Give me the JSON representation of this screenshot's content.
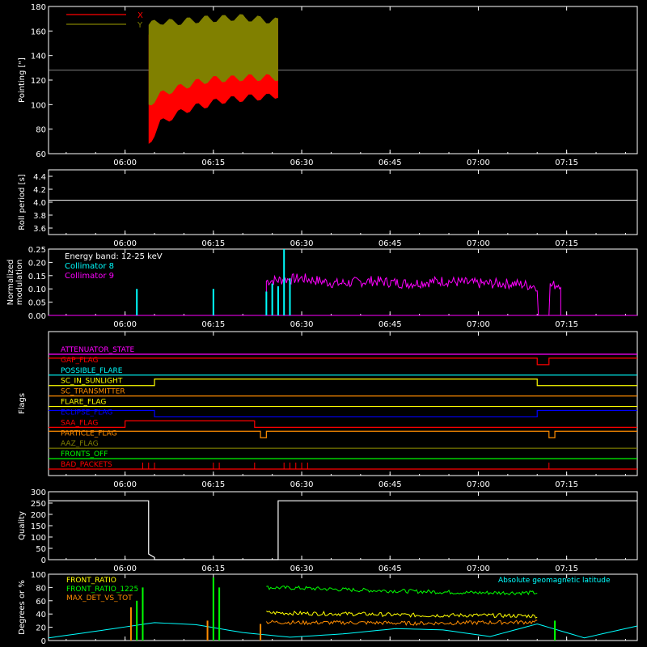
{
  "time_ticks": [
    "06:00",
    "06:15",
    "06:30",
    "06:45",
    "07:00",
    "07:15"
  ],
  "chart_data": [
    {
      "type": "line",
      "panel": "pointing",
      "ylabel": "Pointing [\"]",
      "ylim": [
        60,
        180
      ],
      "yticks": [
        "60",
        "80",
        "100",
        "120",
        "140",
        "160",
        "180"
      ],
      "xlim": [
        "05:47",
        "07:27"
      ],
      "legend": [
        {
          "name": "X",
          "color": "#ff0000"
        },
        {
          "name": "Y",
          "color": "#808000"
        }
      ],
      "reference_value": 128,
      "x": [
        "06:04",
        "06:06",
        "06:08",
        "06:10",
        "06:12",
        "06:14",
        "06:16",
        "06:18",
        "06:20",
        "06:22",
        "06:24",
        "06:26"
      ],
      "series": [
        {
          "name": "X",
          "color": "#ff0000",
          "min": [
            68,
            85,
            90,
            95,
            98,
            100,
            103,
            104,
            105,
            106,
            106,
            108
          ],
          "max": [
            157,
            160,
            162,
            163,
            164,
            165,
            165,
            166,
            167,
            167,
            168,
            168
          ]
        },
        {
          "name": "Y",
          "color": "#808000",
          "min": [
            100,
            108,
            112,
            115,
            118,
            120,
            121,
            121,
            122,
            122,
            122,
            122
          ],
          "max": [
            165,
            168,
            167,
            168,
            169,
            170,
            170,
            171,
            171,
            170,
            169,
            168
          ]
        }
      ]
    },
    {
      "type": "line",
      "panel": "roll_period",
      "ylabel": "Roll period [s]",
      "ylim": [
        3.5,
        4.5
      ],
      "yticks": [
        "3.6",
        "3.8",
        "4.0",
        "4.2",
        "4.4"
      ],
      "series": [
        {
          "name": "",
          "color": "#ffffff",
          "x": [
            "05:47",
            "07:27"
          ],
          "y": [
            4.03,
            4.03
          ]
        }
      ]
    },
    {
      "type": "line",
      "panel": "modulation",
      "ylabel": [
        "Normalized",
        "modulation"
      ],
      "ylim": [
        0,
        0.25
      ],
      "yticks": [
        "0.00",
        "0.05",
        "0.10",
        "0.15",
        "0.20",
        "0.25"
      ],
      "annotation": "Energy band: 12-25 keV",
      "legend": [
        {
          "name": "Collimator 8",
          "color": "#00ffff"
        },
        {
          "name": "Collimator 9",
          "color": "#ff00ff"
        }
      ],
      "series": [
        {
          "name": "Collimator 8",
          "color": "#00ffff",
          "spikes": [
            [
              "06:02",
              0.1
            ],
            [
              "06:15",
              0.1
            ],
            [
              "06:24",
              0.09
            ],
            [
              "06:25",
              0.12
            ],
            [
              "06:26",
              0.11
            ],
            [
              "06:27",
              0.25
            ],
            [
              "06:28",
              0.14
            ]
          ]
        },
        {
          "name": "Collimator 9",
          "color": "#ff00ff",
          "x": [
            "06:24",
            "06:30",
            "06:36",
            "06:42",
            "06:48",
            "06:54",
            "07:00",
            "07:06",
            "07:10",
            "07:12",
            "07:14"
          ],
          "y": [
            0.13,
            0.14,
            0.12,
            0.13,
            0.12,
            0.13,
            0.12,
            0.12,
            0.11,
            0.11,
            0.12
          ]
        }
      ]
    },
    {
      "type": "line",
      "panel": "flags",
      "ylabel": "Flags",
      "flags": [
        {
          "name": "ATTENUATOR_STATE",
          "color": "#ff00ff"
        },
        {
          "name": "GAP_FLAG",
          "color": "#ff0000"
        },
        {
          "name": "POSSIBLE_FLARE",
          "color": "#00ffff"
        },
        {
          "name": "SC_IN_SUNLIGHT",
          "color": "#ffff00"
        },
        {
          "name": "SC_TRANSMITTER",
          "color": "#ff8c00"
        },
        {
          "name": "FLARE_FLAG",
          "color": "#ffff00"
        },
        {
          "name": "ECLIPSE_FLAG",
          "color": "#0000ff"
        },
        {
          "name": "SAA_FLAG",
          "color": "#ff0000"
        },
        {
          "name": "PARTICLE_FLAG",
          "color": "#ff8c00"
        },
        {
          "name": "AAZ_FLAG",
          "color": "#808000"
        },
        {
          "name": "FRONTS_OFF",
          "color": "#00ff00"
        },
        {
          "name": "BAD_PACKETS",
          "color": "#ff0000"
        }
      ]
    },
    {
      "type": "line",
      "panel": "quality",
      "ylabel": "Quality",
      "ylim": [
        0,
        300
      ],
      "yticks": [
        "0",
        "50",
        "100",
        "150",
        "200",
        "250",
        "300"
      ],
      "series": [
        {
          "name": "",
          "color": "#ffffff",
          "x": [
            "05:47",
            "06:04",
            "06:04",
            "06:05",
            "06:05",
            "06:26",
            "06:26",
            "07:27"
          ],
          "y": [
            260,
            260,
            25,
            10,
            0,
            0,
            260,
            260
          ]
        }
      ]
    },
    {
      "type": "line",
      "panel": "ratios",
      "ylabel": "Degrees or %",
      "ylim": [
        0,
        100
      ],
      "yticks": [
        "0",
        "20",
        "40",
        "60",
        "80",
        "100"
      ],
      "legend": [
        {
          "name": "FRONT_RATIO",
          "color": "#ffff00"
        },
        {
          "name": "FRONT_RATIO_1225",
          "color": "#00ff00"
        },
        {
          "name": "MAX_DET_VS_TOT",
          "color": "#ff8c00"
        },
        {
          "name": "Absolute geomagnetic latitude",
          "color": "#00ffff"
        }
      ],
      "series": [
        {
          "name": "FRONT_RATIO_1225",
          "color": "#00ff00",
          "x": [
            "06:24",
            "06:30",
            "06:40",
            "06:50",
            "07:00",
            "07:10"
          ],
          "y": [
            80,
            79,
            76,
            74,
            72,
            72
          ]
        },
        {
          "name": "FRONT_RATIO",
          "color": "#ffff00",
          "x": [
            "06:24",
            "06:30",
            "06:40",
            "06:50",
            "07:00",
            "07:10"
          ],
          "y": [
            42,
            41,
            40,
            38,
            38,
            37
          ]
        },
        {
          "name": "MAX_DET_VS_TOT",
          "color": "#ff8c00",
          "x": [
            "06:24",
            "06:30",
            "06:40",
            "06:50",
            "07:00",
            "07:10"
          ],
          "y": [
            28,
            27,
            27,
            26,
            27,
            28
          ]
        },
        {
          "name": "Absolute geomagnetic latitude",
          "color": "#00ffff",
          "x": [
            "05:47",
            "05:55",
            "06:05",
            "06:12",
            "06:20",
            "06:28",
            "06:37",
            "06:46",
            "06:54",
            "07:02",
            "07:10",
            "07:18",
            "07:27"
          ],
          "y": [
            4,
            14,
            27,
            24,
            12,
            5,
            10,
            18,
            16,
            6,
            25,
            4,
            22
          ]
        }
      ]
    }
  ]
}
